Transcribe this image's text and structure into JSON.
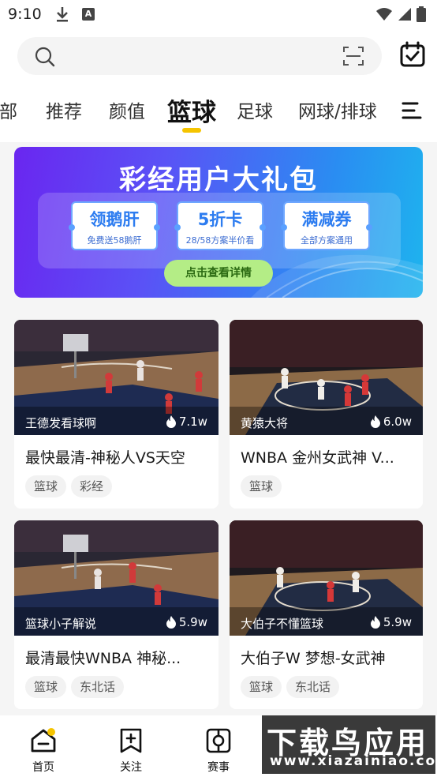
{
  "status": {
    "time": "9:10"
  },
  "search": {
    "placeholder": ""
  },
  "tabs": [
    {
      "label": "全部"
    },
    {
      "label": "推荐"
    },
    {
      "label": "颜值"
    },
    {
      "label": "篮球",
      "active": true
    },
    {
      "label": "足球"
    },
    {
      "label": "网球/排球"
    }
  ],
  "banner": {
    "title": "彩经用户大礼包",
    "coupons": [
      {
        "title": "领鹅肝",
        "subtitle": "免费送58鹅肝"
      },
      {
        "title": "5折卡",
        "subtitle": "28/58方案半价看"
      },
      {
        "title": "满减券",
        "subtitle": "全部方案通用"
      }
    ],
    "cta": "点击查看详情"
  },
  "cards": [
    {
      "author": "王德发看球啊",
      "views": "7.1w",
      "title": "最快最清-神秘人VS天空",
      "tags": [
        "篮球",
        "彩经"
      ]
    },
    {
      "author": "黄猿大将",
      "views": "6.0w",
      "title": "WNBA 金州女武神 V...",
      "tags": [
        "篮球"
      ]
    },
    {
      "author": "篮球小子解说",
      "views": "5.9w",
      "title": "最清最快WNBA 神秘...",
      "tags": [
        "篮球",
        "东北话"
      ]
    },
    {
      "author": "大伯子不懂篮球",
      "views": "5.9w",
      "title": "大伯子W 梦想-女武神",
      "tags": [
        "篮球",
        "东北话"
      ]
    }
  ],
  "bottom_nav": [
    {
      "label": "首页",
      "icon": "home-icon",
      "active": true
    },
    {
      "label": "关注",
      "icon": "follow-icon"
    },
    {
      "label": "赛事",
      "icon": "match-icon"
    }
  ],
  "watermark": {
    "line1": "下载鸟应用",
    "line2": "www.xiazainiao.com"
  },
  "colors": {
    "accent": "#f5c400",
    "banner_start": "#6a26f0",
    "banner_end": "#1eb4ee",
    "cta": "#b4ed86"
  }
}
